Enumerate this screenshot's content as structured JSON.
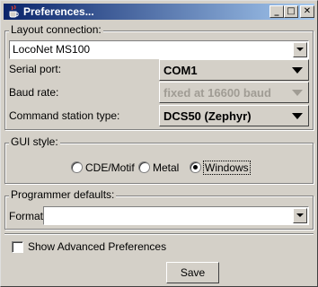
{
  "window": {
    "title": "Preferences...",
    "icon": "java-cup-icon",
    "controls": {
      "minimize": "_",
      "maximize": "□",
      "close": "✕"
    }
  },
  "layout_connection": {
    "legend": "Layout connection:",
    "connection_value": "LocoNet MS100",
    "serial_port": {
      "label": "Serial port:",
      "value": "COM1"
    },
    "baud_rate": {
      "label": "Baud rate:",
      "value": "fixed at 16600 baud"
    },
    "command_station": {
      "label": "Command station type:",
      "value": "DCS50 (Zephyr)"
    }
  },
  "gui_style": {
    "legend": "GUI style:",
    "options": [
      {
        "label": "CDE/Motif",
        "selected": false
      },
      {
        "label": "Metal",
        "selected": false
      },
      {
        "label": "Windows",
        "selected": true
      }
    ]
  },
  "programmer_defaults": {
    "legend": "Programmer defaults:",
    "format": {
      "label": "Format:",
      "value": ""
    }
  },
  "advanced": {
    "label": "Show Advanced Preferences",
    "checked": false
  },
  "save_label": "Save"
}
